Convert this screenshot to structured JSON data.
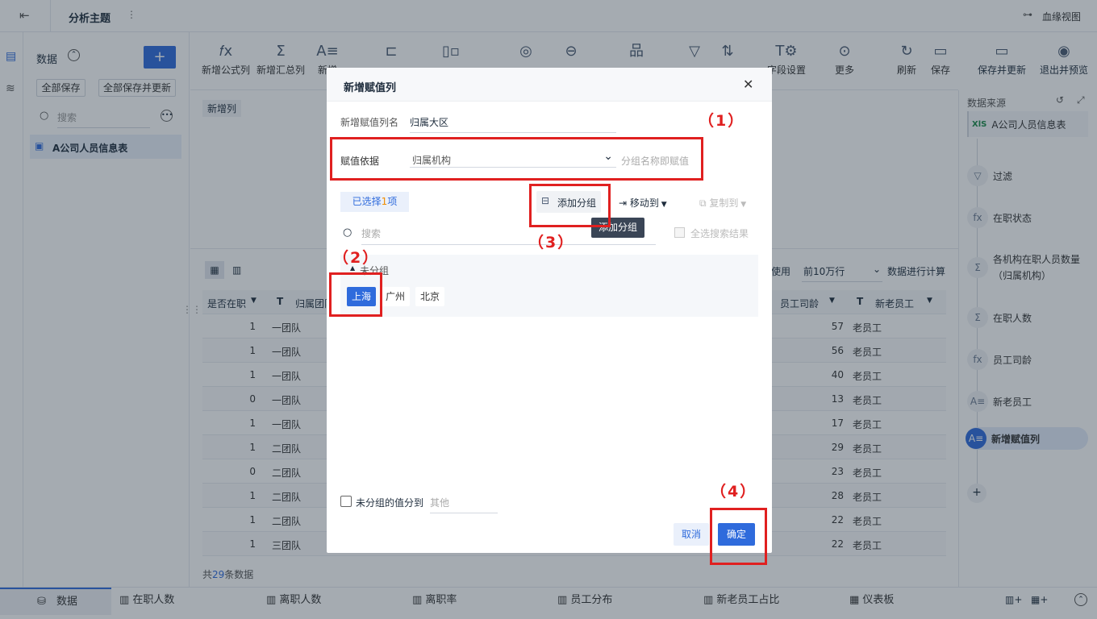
{
  "topbar": {
    "title": "分析主题",
    "lineage": "血缘视图"
  },
  "left": {
    "title": "数据",
    "add": "+",
    "save_all": "全部保存",
    "save_all_update": "全部保存并更新",
    "search_placeholder": "搜索",
    "table_item": "A公司人员信息表"
  },
  "toolbar": {
    "tools": [
      "新增公式列",
      "新增汇总列",
      "新增",
      "",
      "",
      "",
      "",
      "",
      "",
      "",
      "字段设置",
      "更多",
      "刷新",
      "保存",
      "保存并更新",
      "退出并预览"
    ]
  },
  "main": {
    "new_col_tag": "新增列",
    "use_text": "使用",
    "rows_select": "前10万行",
    "calc_text": "数据进行计算",
    "headers": [
      "是否在职",
      "归属团队",
      "员工司龄",
      "新老员工"
    ],
    "rows": [
      {
        "a": "1",
        "b": "一团队",
        "c": "57",
        "d": "老员工"
      },
      {
        "a": "1",
        "b": "一团队",
        "c": "56",
        "d": "老员工"
      },
      {
        "a": "1",
        "b": "一团队",
        "c": "40",
        "d": "老员工"
      },
      {
        "a": "0",
        "b": "一团队",
        "c": "13",
        "d": "老员工"
      },
      {
        "a": "1",
        "b": "一团队",
        "c": "17",
        "d": "老员工"
      },
      {
        "a": "1",
        "b": "二团队",
        "c": "29",
        "d": "老员工"
      },
      {
        "a": "0",
        "b": "二团队",
        "c": "23",
        "d": "老员工"
      },
      {
        "a": "1",
        "b": "二团队",
        "c": "28",
        "d": "老员工"
      },
      {
        "a": "1",
        "b": "二团队",
        "c": "22",
        "d": "老员工"
      },
      {
        "a": "1",
        "b": "三团队",
        "c": "22",
        "d": "老员工"
      }
    ],
    "count_prefix": "共",
    "count": "29",
    "count_suffix": "条数据"
  },
  "right": {
    "title": "数据来源",
    "nodes": [
      "A公司人员信息表",
      "过滤",
      "在职状态",
      "各机构在职人员数量（归属机构）",
      "在职人数",
      "员工司龄",
      "新老员工",
      "新增赋值列"
    ],
    "add": "+"
  },
  "bottom": {
    "tabs": [
      "数据",
      "在职人数",
      "离职人数",
      "离职率",
      "员工分布",
      "新老员工占比",
      "仪表板"
    ]
  },
  "dialog": {
    "title": "新增赋值列",
    "name_label": "新增赋值列名",
    "name_value": "归属大区",
    "basis_label": "赋值依据",
    "basis_value": "归属机构",
    "basis_hint": "分组名称即赋值",
    "selected_prefix": "已选择",
    "selected_count": "1",
    "selected_suffix": "项",
    "add_group": "添加分组",
    "move_to": "移动到",
    "copy_to": "复制到",
    "tooltip": "添加分组",
    "search_placeholder": "搜索",
    "select_all_results": "全选搜索结果",
    "ungrouped": "未分组",
    "chips": [
      "上海",
      "广州",
      "北京"
    ],
    "ungrouped_to": "未分组的值分到",
    "other_placeholder": "其他",
    "cancel": "取消",
    "confirm": "确定"
  },
  "annotations": [
    "（1）",
    "（2）",
    "（3）",
    "（4）"
  ],
  "colors": {
    "primary": "#2f6bdc",
    "annotation": "#e02020"
  }
}
